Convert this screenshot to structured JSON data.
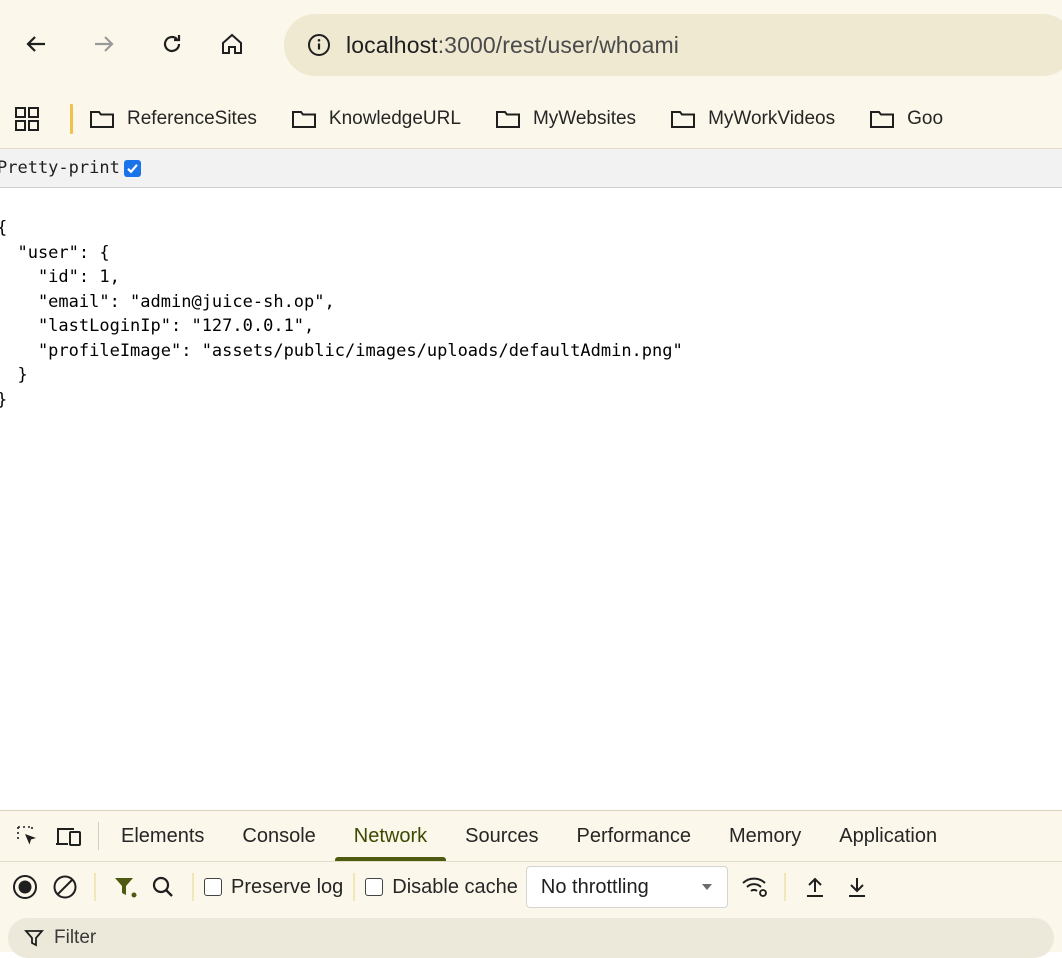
{
  "browser": {
    "url_host": "localhost",
    "url_rest": ":3000/rest/user/whoami"
  },
  "bookmarks": [
    {
      "label": "ReferenceSites"
    },
    {
      "label": "KnowledgeURL"
    },
    {
      "label": "MyWebsites"
    },
    {
      "label": "MyWorkVideos"
    },
    {
      "label": "Goo"
    }
  ],
  "page": {
    "pretty_print_label": "Pretty-print",
    "pretty_print_checked": true,
    "json_text": "{\n  \"user\": {\n    \"id\": 1,\n    \"email\": \"admin@juice-sh.op\",\n    \"lastLoginIp\": \"127.0.0.1\",\n    \"profileImage\": \"assets/public/images/uploads/defaultAdmin.png\"\n  }\n}"
  },
  "devtools": {
    "tabs": [
      {
        "label": "Elements"
      },
      {
        "label": "Console"
      },
      {
        "label": "Network",
        "active": true
      },
      {
        "label": "Sources"
      },
      {
        "label": "Performance"
      },
      {
        "label": "Memory"
      },
      {
        "label": "Application"
      }
    ],
    "preserve_log_label": "Preserve log",
    "disable_cache_label": "Disable cache",
    "throttling_value": "No throttling",
    "filter_placeholder": "Filter"
  },
  "colors": {
    "toolbar_bg": "#fbf7ea",
    "omnibox_bg": "#efe9d2",
    "active_tab": "#4d5a0f",
    "checkbox_blue": "#1a73e8"
  }
}
